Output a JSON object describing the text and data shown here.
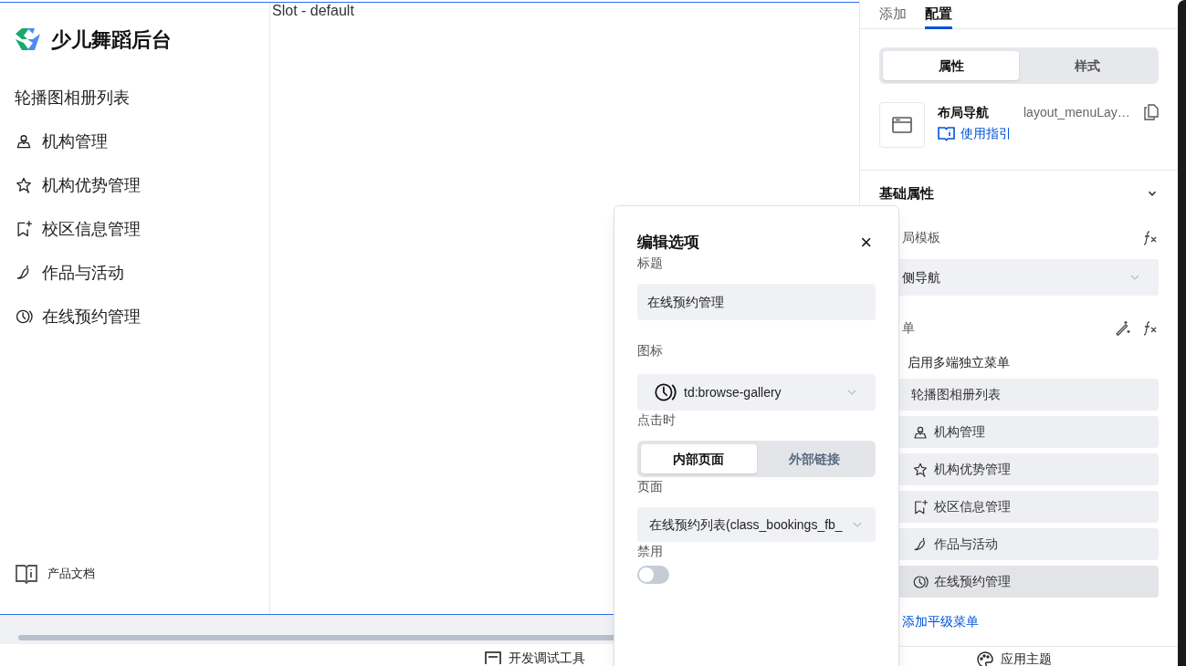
{
  "sidebar": {
    "app_title": "少儿舞蹈后台",
    "items": [
      {
        "label": "轮播图相册列表"
      },
      {
        "label": "机构管理"
      },
      {
        "label": "机构优势管理"
      },
      {
        "label": "校区信息管理"
      },
      {
        "label": "作品与活动"
      },
      {
        "label": "在线预约管理"
      }
    ],
    "footer_link": "产品文档"
  },
  "canvas": {
    "slot_text": "Slot - default"
  },
  "bottom_bar": {
    "dev_tools": "开发调试工具",
    "theme": "应用主题"
  },
  "panel": {
    "tabs": [
      {
        "label": "添加",
        "selected": false
      },
      {
        "label": "配置",
        "selected": true
      }
    ],
    "segments": [
      {
        "label": "属性",
        "selected": true
      },
      {
        "label": "样式",
        "selected": false
      }
    ],
    "component": {
      "name": "布局导航",
      "id": "layout_menuLay…",
      "guide": "使用指引"
    },
    "section": {
      "title": "基础属性",
      "expanded": true
    },
    "template_label": "局模板",
    "template_value": "侧导航",
    "menu_label": "单",
    "multi_menu": "启用多端独立菜单",
    "menu_items": [
      {
        "label": "轮播图相册列表",
        "selected": false
      },
      {
        "label": "机构管理",
        "selected": false
      },
      {
        "label": "机构优势管理",
        "selected": false
      },
      {
        "label": "校区信息管理",
        "selected": false
      },
      {
        "label": "作品与活动",
        "selected": false
      },
      {
        "label": "在线预约管理",
        "selected": true
      }
    ],
    "add_sibling": "添加平级菜单"
  },
  "dialog": {
    "title": "编辑选项",
    "close": "×",
    "title_label": "标题",
    "title_value": "在线预约管理",
    "icon_label": "图标",
    "icon_value": "td:browse-gallery",
    "click_label": "点击时",
    "click_options": [
      {
        "label": "内部页面",
        "selected": true
      },
      {
        "label": "外部链接",
        "selected": false
      }
    ],
    "page_label": "页面",
    "page_value": "在线预约列表(class_bookings_fb_",
    "disabled_label": "禁用",
    "disabled": {
      "on": false
    }
  }
}
